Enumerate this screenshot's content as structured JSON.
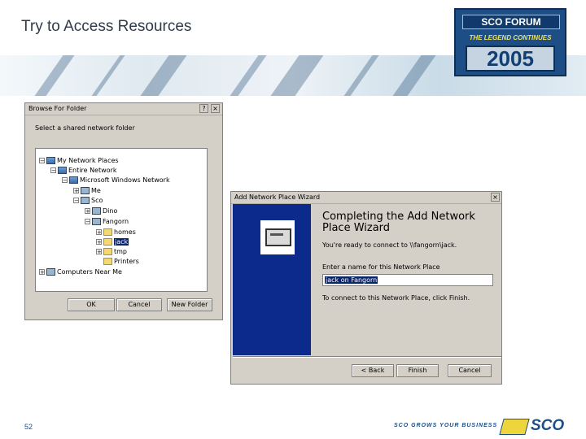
{
  "slide": {
    "title": "Try to  Access Resources",
    "page_number": "52",
    "tagline": "SCO GROWS YOUR BUSINESS",
    "footer_logo": "SCO"
  },
  "header_logo": {
    "line1": "SCO FORUM",
    "line2": "THE LEGEND CONTINUES",
    "year": "2005"
  },
  "browse_dialog": {
    "title": "Browse For Folder",
    "help_glyph": "?",
    "close_glyph": "×",
    "prompt": "Select a shared network folder",
    "tree": [
      {
        "label": "My Network Places",
        "icon": "network-places-icon",
        "expander": "−"
      },
      {
        "label": "Entire Network",
        "icon": "globe-icon",
        "expander": "−"
      },
      {
        "label": "Microsoft Windows Network",
        "icon": "network-icon",
        "expander": "−"
      },
      {
        "label": "Me",
        "icon": "workgroup-icon",
        "expander": "+"
      },
      {
        "label": "Sco",
        "icon": "workgroup-icon",
        "expander": "−"
      },
      {
        "label": "Dino",
        "icon": "computer-icon",
        "expander": "+"
      },
      {
        "label": "Fangorn",
        "icon": "computer-icon",
        "expander": "−"
      },
      {
        "label": "homes",
        "icon": "shared-folder-icon",
        "expander": "+"
      },
      {
        "label": "jack",
        "icon": "shared-folder-icon",
        "expander": "+",
        "selected": true
      },
      {
        "label": "tmp",
        "icon": "shared-folder-icon",
        "expander": "+"
      },
      {
        "label": "Printers",
        "icon": "printers-folder-icon",
        "expander": ""
      },
      {
        "label": "Computers Near Me",
        "icon": "computers-near-me-icon",
        "expander": "+"
      }
    ],
    "ok_label": "OK",
    "cancel_label": "Cancel",
    "new_folder_label": "New Folder"
  },
  "wizard": {
    "title": "Add Network Place Wizard",
    "close_glyph": "×",
    "heading": "Completing the Add Network Place Wizard",
    "ready_text": "You're ready to connect to \\\\fangorn\\jack.",
    "name_label": "Enter a name for this Network Place",
    "name_value": "jack on Fangorn",
    "finish_hint": "To connect to this Network Place, click Finish.",
    "back_label": "< Back",
    "finish_label": "Finish",
    "cancel_label": "Cancel"
  }
}
